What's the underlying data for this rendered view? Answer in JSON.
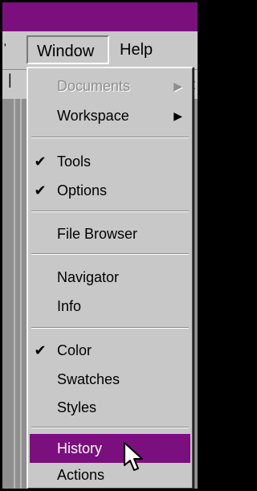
{
  "colors": {
    "titlebar": "#7b0f7e",
    "highlight": "#7b0f7e",
    "menu_background": "#c8c8c8",
    "workspace": "#8f8f8f",
    "disabled_text": "#8e8e8e"
  },
  "menubar": {
    "window_label": "Window",
    "help_label": "Help"
  },
  "menu": {
    "documents": {
      "label": "Documents",
      "disabled": true,
      "submenu": true
    },
    "workspace": {
      "label": "Workspace",
      "submenu": true
    },
    "tools": {
      "label": "Tools",
      "checked": true
    },
    "options": {
      "label": "Options",
      "checked": true
    },
    "file_browser": {
      "label": "File Browser"
    },
    "navigator": {
      "label": "Navigator"
    },
    "info": {
      "label": "Info"
    },
    "color": {
      "label": "Color",
      "checked": true
    },
    "swatches": {
      "label": "Swatches"
    },
    "styles": {
      "label": "Styles"
    },
    "history": {
      "label": "History",
      "highlighted": true
    },
    "actions": {
      "label": "Actions"
    }
  },
  "glyphs": {
    "check": "✔",
    "submenu_arrow": "▶"
  },
  "icons": {
    "cursor": "arrow-pointer-icon"
  }
}
